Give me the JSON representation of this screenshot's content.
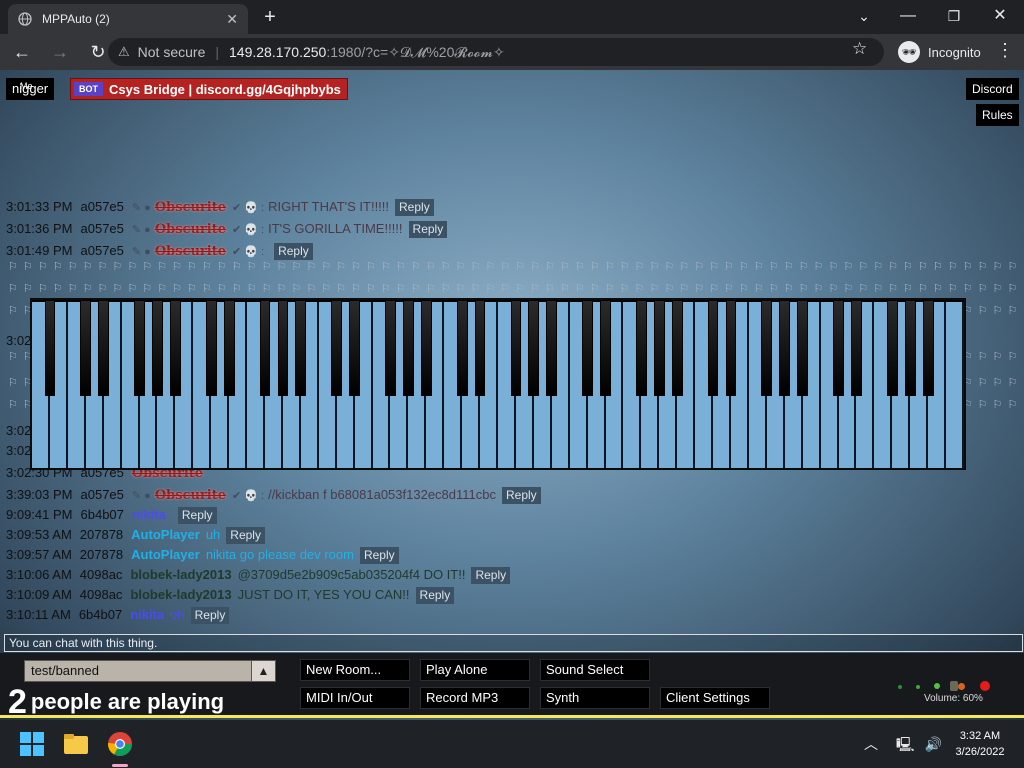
{
  "browser": {
    "tab_title": "MPPAuto (2)",
    "tab_close": "✕",
    "new_tab": "+",
    "window_controls": {
      "minimize": "—",
      "maximize": "❐",
      "close": "✕"
    },
    "tabs_dropdown": "⌄",
    "url_warning": "Not secure",
    "url_host": "149.28.170.250",
    "url_path": ":1980/?c=✧𝓓𝓜%20𝓡𝓸𝓸𝓶✧",
    "incognito_label": "Incognito"
  },
  "page": {
    "me_tag": {
      "small": "Me",
      "name": "nigger"
    },
    "bot_tag": {
      "badge": "BOT",
      "name": "Csys Bridge | discord.gg/4Gqjhpbybs"
    },
    "discord_button": "Discord",
    "rules_button": "Rules",
    "reply_label": "Reply",
    "chat": [
      {
        "time": "3:01:33 PM",
        "uid": "a057e5",
        "name": "Obscurite",
        "text": "RIGHT THAT'S IT!!!!!",
        "color": "#8a1c1c",
        "style": "obsc"
      },
      {
        "time": "3:01:36 PM",
        "uid": "a057e5",
        "name": "Obscurite",
        "text": "IT'S GORILLA TIME!!!!!",
        "color": "#8a1c1c",
        "style": "obsc"
      },
      {
        "time": "3:01:49 PM",
        "uid": "a057e5",
        "name": "Obscurite",
        "text": "",
        "color": "#8a1c1c",
        "style": "obsc"
      },
      {
        "time": "3:39:03 PM",
        "uid": "a057e5",
        "name": "Obscurite",
        "text": "//kickban f b68081a053f132ec8d111cbc",
        "color": "#8a1c1c",
        "style": "obsc"
      },
      {
        "time": "9:09:41 PM",
        "uid": "6b4b07",
        "name": "nikita",
        "text": "",
        "color": "#4a4cf0",
        "style": "plain"
      },
      {
        "time": "3:09:53 AM",
        "uid": "207878",
        "name": "AutoPlayer",
        "text": "uh",
        "color": "#1fb0e8",
        "style": "plain"
      },
      {
        "time": "3:09:57 AM",
        "uid": "207878",
        "name": "AutoPlayer",
        "text": "nikita go please dev room",
        "color": "#1fb0e8",
        "style": "plain"
      },
      {
        "time": "3:10:06 AM",
        "uid": "4098ac",
        "name": "blobek-lady2013",
        "text": "@3709d5e2b909c5ab035204f4 DO IT!!",
        "color": "#1f3a2a",
        "style": "plain"
      },
      {
        "time": "3:10:09 AM",
        "uid": "4098ac",
        "name": "blobek-lady2013",
        "text": "JUST DO IT, YES YOU CAN!!",
        "color": "#1f3a2a",
        "style": "plain"
      },
      {
        "time": "3:10:11 AM",
        "uid": "6b4b07",
        "name": "nikita",
        "text": "oh",
        "color": "#4a4cf0",
        "style": "plain"
      }
    ],
    "hidden_rows": [
      {
        "time": "3:02"
      },
      {
        "time": "3:02"
      },
      {
        "time": "3:02"
      },
      {
        "time": "3:02:30 PM",
        "uid": "a057e5",
        "name": "Obscurite"
      }
    ],
    "chat_input_placeholder": "You can chat with this thing.",
    "room_select": "test/banned",
    "room_select_arrow": "▲",
    "players_count": "2",
    "players_text": "people are playing",
    "controls": {
      "new_room": "New Room...",
      "play_alone": "Play Alone",
      "sound_select": "Sound Select",
      "midi": "MIDI In/Out",
      "record": "Record MP3",
      "synth": "Synth",
      "client_settings": "Client Settings"
    },
    "volume_label": "Volume: 60%",
    "volume_percent": 60
  },
  "taskbar": {
    "time": "3:32 AM",
    "date": "3/26/2022",
    "tray_chevron": "︿"
  },
  "colors": {
    "piano_white": "#7ab0d8",
    "accent_yellow": "#f5e85b"
  }
}
